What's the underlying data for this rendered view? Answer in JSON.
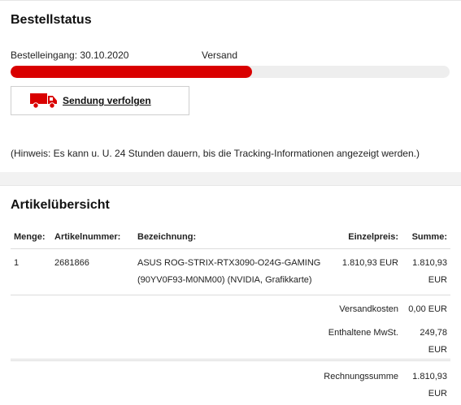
{
  "order_status": {
    "title": "Bestellstatus",
    "received_label": "Bestelleingang: 30.10.2020",
    "shipping_label": "Versand",
    "progress": 0.55,
    "progress_color": "#d90000",
    "track_button_label": "Sendung verfolgen",
    "track_icon": "truck-icon",
    "hint": "(Hinweis: Es kann u. U. 24 Stunden dauern, bis die Tracking-Informationen angezeigt werden.)"
  },
  "overview": {
    "title": "Artikelübersicht",
    "headers": [
      "Menge:",
      "Artikelnummer:",
      "Bezeichnung:",
      "Einzelpreis:",
      "Summe:"
    ],
    "item": {
      "qty": "1",
      "article_number": "2681866",
      "name": "ASUS ROG-STRIX-RTX3090-O24G-GAMING",
      "name_detail": "(90YV0F93-M0NM00) (NVIDIA, Grafikkarte)",
      "unit_price": "1.810,93 EUR",
      "sum": "1.810,93",
      "sum_currency": "EUR"
    },
    "shipping_cost_label": "Versandkosten",
    "shipping_cost_value": "0,00 EUR",
    "vat_label": "Enthaltene MwSt.",
    "vat_value": "249,78",
    "vat_currency": "EUR",
    "total_label": "Rechnungssumme",
    "total_value": "1.810,93",
    "total_currency": "EUR"
  }
}
